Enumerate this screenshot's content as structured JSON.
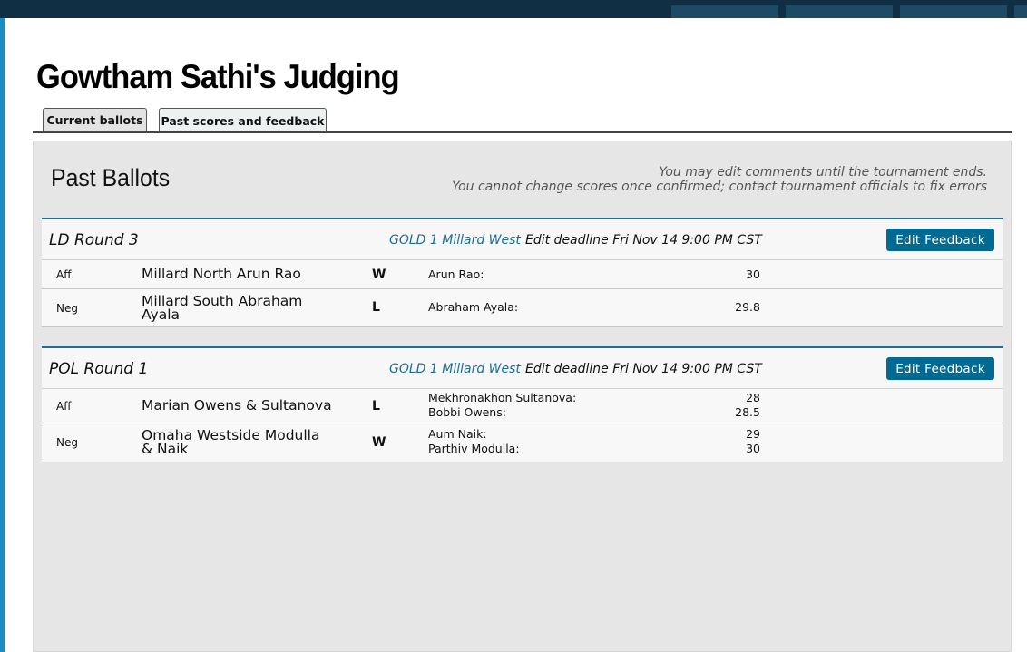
{
  "page": {
    "title": "Gowtham Sathi's Judging"
  },
  "tabs": [
    {
      "label": "Current ballots",
      "active": false
    },
    {
      "label": "Past scores and feedback",
      "active": true
    }
  ],
  "panel": {
    "title": "Past Ballots",
    "note1": "You may edit comments until the tournament ends.",
    "note2": "You cannot change scores once confirmed; contact tournament officials to fix errors"
  },
  "ballots": [
    {
      "round": "LD Round 3",
      "event": "GOLD 1 Millard West",
      "deadline": "Edit deadline Fri Nov 14 9:00 PM CST",
      "button": "Edit Feedback",
      "rows": [
        {
          "side": "Aff",
          "entry": "Millard North Arun Rao",
          "result": "W",
          "speakers": [
            {
              "name": "Arun Rao:",
              "points": "30"
            }
          ]
        },
        {
          "side": "Neg",
          "entry": "Millard South Abraham Ayala",
          "result": "L",
          "speakers": [
            {
              "name": "Abraham Ayala:",
              "points": "29.8"
            }
          ]
        }
      ]
    },
    {
      "round": "POL Round 1",
      "event": "GOLD 1 Millard West",
      "deadline": "Edit deadline Fri Nov 14 9:00 PM CST",
      "button": "Edit Feedback",
      "rows": [
        {
          "side": "Aff",
          "entry": "Marian Owens & Sultanova",
          "result": "L",
          "speakers": [
            {
              "name": "Mekhronakhon Sultanova:",
              "points": "28"
            },
            {
              "name": "Bobbi Owens:",
              "points": "28.5"
            }
          ]
        },
        {
          "side": "Neg",
          "entry": "Omaha Westside Modulla & Naik",
          "result": "W",
          "speakers": [
            {
              "name": "Aum Naik:",
              "points": "29"
            },
            {
              "name": "Parthiv Modulla:",
              "points": "30"
            }
          ]
        }
      ]
    }
  ],
  "colors": {
    "accent": "#1b6e96",
    "button": "#006a93",
    "topbar": "#102f44"
  }
}
